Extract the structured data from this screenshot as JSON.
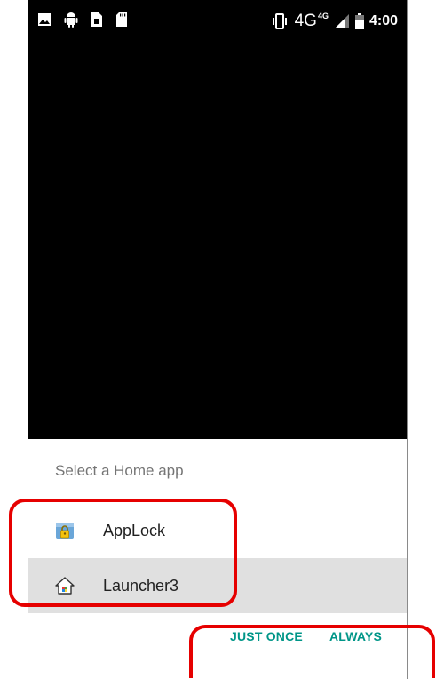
{
  "status_bar": {
    "time": "4:00",
    "network": "4G",
    "network_sup": "4G",
    "left_icons": [
      "image-icon",
      "android-icon",
      "sim-card-icon",
      "sd-card-icon"
    ],
    "right_icons": [
      "vibrate-icon",
      "signal-icon",
      "battery-icon"
    ]
  },
  "dialog": {
    "title": "Select a Home app",
    "apps": [
      {
        "label": "AppLock",
        "icon": "applock-icon",
        "selected": false
      },
      {
        "label": "Launcher3",
        "icon": "home-icon",
        "selected": true
      }
    ],
    "actions": {
      "just_once": "JUST ONCE",
      "always": "ALWAYS"
    }
  },
  "colors": {
    "accent": "#009688",
    "selected_row": "#e0e0e0",
    "annotation": "#e60000"
  }
}
